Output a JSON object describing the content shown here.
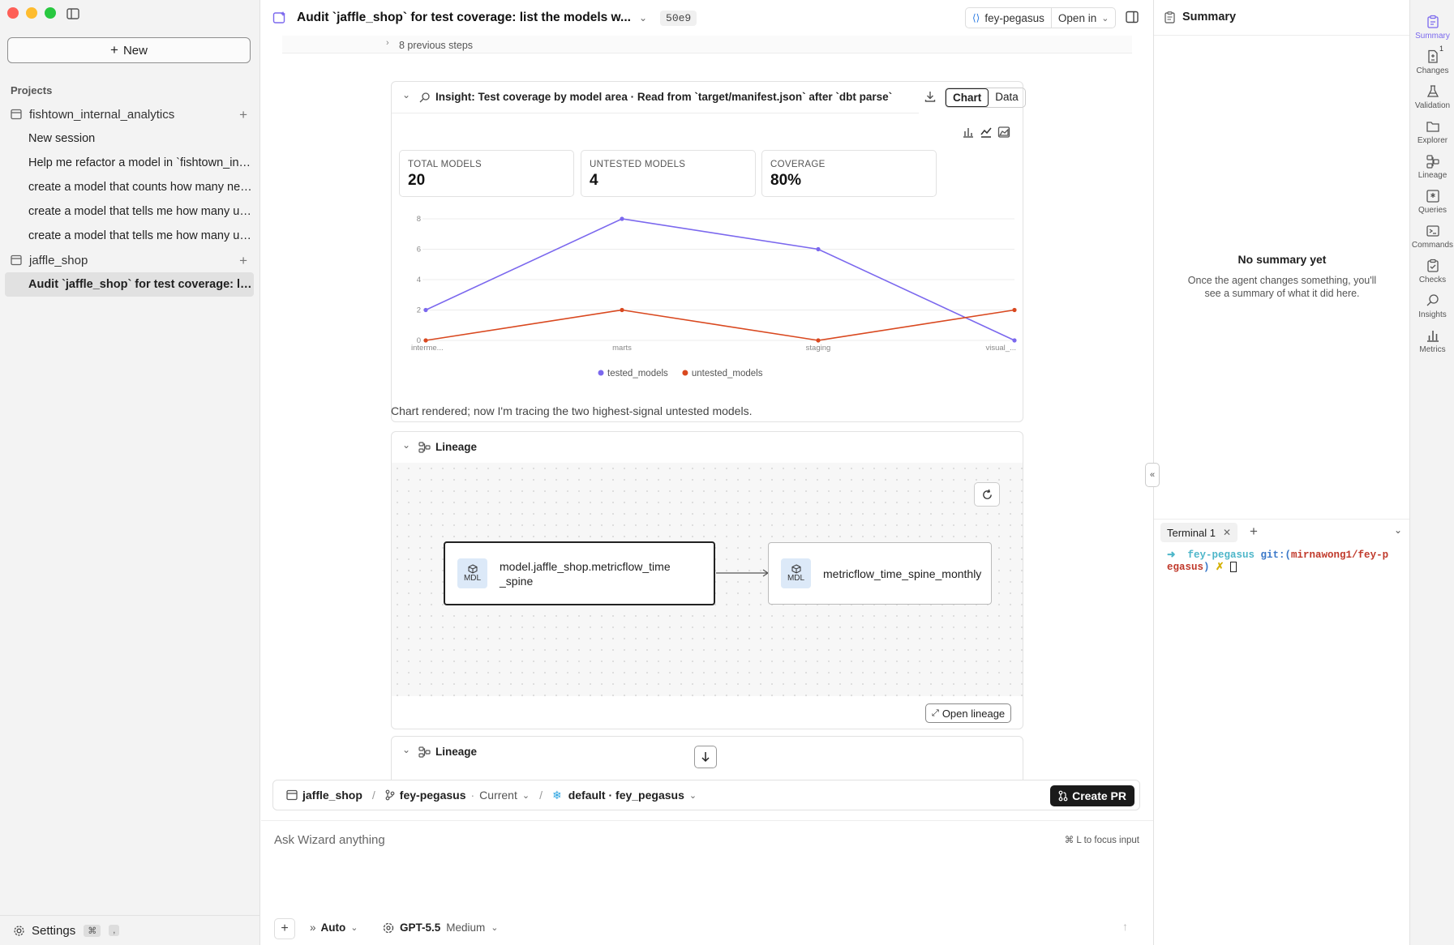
{
  "sidebar": {
    "new_label": "New",
    "projects_label": "Projects",
    "projects": [
      {
        "name": "fishtown_internal_analytics",
        "sessions": [
          "New session",
          "Help me refactor a model in `fishtown_inte...",
          "create a model that counts how many new...",
          "create a model that tells me how many use...",
          "create a model that tells me how many use..."
        ]
      },
      {
        "name": "jaffle_shop",
        "sessions": [
          "Audit `jaffle_shop` for test coverage: list t..."
        ]
      }
    ],
    "settings_label": "Settings",
    "settings_kbd": [
      "⌘",
      ","
    ]
  },
  "topbar": {
    "title": "Audit `jaffle_shop` for test coverage: list the models w...",
    "hash": "50e9",
    "branch": "fey-pegasus",
    "open_in": "Open in"
  },
  "main": {
    "previous_steps": "8 previous steps",
    "insight": {
      "header": "Insight: Test coverage by model area · Read from `target/manifest.json` after `dbt parse`",
      "tabs": [
        "Chart",
        "Data"
      ],
      "kpis": [
        {
          "label": "TOTAL MODELS",
          "value": "20"
        },
        {
          "label": "UNTESTED MODELS",
          "value": "4"
        },
        {
          "label": "COVERAGE",
          "value": "80%"
        }
      ]
    },
    "message": "Chart rendered; now I'm tracing the two highest-signal untested models.",
    "lineage": {
      "header": "Lineage",
      "nodes": [
        {
          "badge": "MDL",
          "label_line1": "model.jaffle_shop.metricflow_time",
          "label_line2": "_spine"
        },
        {
          "badge": "MDL",
          "label_line1": "metricflow_time_spine_monthly",
          "label_line2": ""
        }
      ],
      "open_label": "Open lineage"
    },
    "lineage2_header": "Lineage"
  },
  "chart_data": {
    "type": "line",
    "categories": [
      "interme...",
      "marts",
      "staging",
      "visual_..."
    ],
    "series": [
      {
        "name": "tested_models",
        "values": [
          2,
          8,
          6,
          0
        ],
        "color": "#7b68ee"
      },
      {
        "name": "untested_models",
        "values": [
          0,
          2,
          0,
          2
        ],
        "color": "#d9481f"
      }
    ],
    "yticks": [
      0,
      2,
      4,
      6,
      8
    ],
    "ylim": [
      0,
      8
    ],
    "grid": true,
    "legend": "bottom"
  },
  "composer": {
    "project": "jaffle_shop",
    "branch": "fey-pegasus",
    "branch_state": "Current",
    "env": "default · fey_pegasus",
    "create_pr": "Create PR",
    "placeholder": "Ask Wizard anything",
    "focus_hint": "⌘ L to focus input",
    "mode": "Auto",
    "model": "GPT-5.5",
    "effort": "Medium"
  },
  "summary": {
    "title": "Summary",
    "empty_title": "No summary yet",
    "empty_line1": "Once the agent changes something, you'll",
    "empty_line2": "see a summary of what it did here.",
    "terminal_tab": "Terminal 1",
    "terminal_user": "fey-pegasus",
    "terminal_git": "git:(",
    "terminal_branch_1": "mirnawong1/fey-p",
    "terminal_branch_2": "egasus",
    "terminal_close": ")",
    "terminal_x": "✗"
  },
  "rail": [
    {
      "label": "Summary",
      "icon": "clipboard-icon"
    },
    {
      "label": "Changes",
      "icon": "file-diff-icon",
      "badge": "1"
    },
    {
      "label": "Validation",
      "icon": "flask-icon"
    },
    {
      "label": "Explorer",
      "icon": "folder-icon"
    },
    {
      "label": "Lineage",
      "icon": "lineage-icon"
    },
    {
      "label": "Queries",
      "icon": "query-icon"
    },
    {
      "label": "Commands",
      "icon": "terminal-icon"
    },
    {
      "label": "Checks",
      "icon": "checklist-icon"
    },
    {
      "label": "Insights",
      "icon": "insight-icon"
    },
    {
      "label": "Metrics",
      "icon": "bar-chart-icon"
    }
  ],
  "colors": {
    "accent": "#7b68ee",
    "secondary": "#d9481f",
    "terminal_cyan": "#4db6c9",
    "terminal_red": "#c0392b"
  }
}
